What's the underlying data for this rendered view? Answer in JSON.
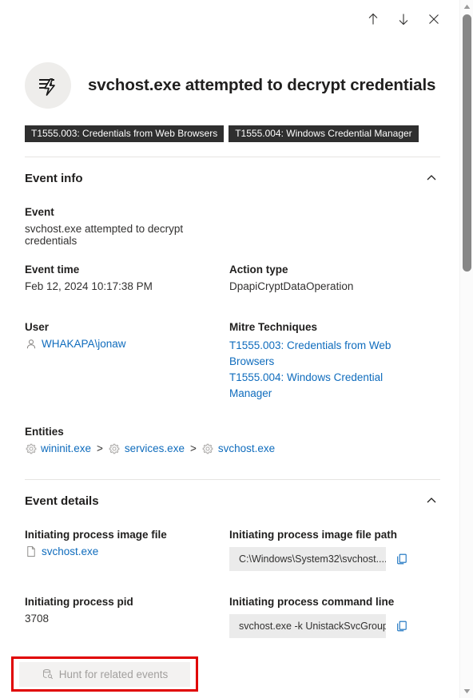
{
  "commandbar": {
    "buttons": [
      {
        "name": "previous-item",
        "icon": "arrow-up-icon",
        "label": "Up"
      },
      {
        "name": "next-item",
        "icon": "arrow-down-icon",
        "label": "Down"
      },
      {
        "name": "close-panel",
        "icon": "close-icon",
        "label": "Close"
      }
    ]
  },
  "header": {
    "icon": "alert-lightning-icon",
    "title": "svchost.exe attempted to decrypt credentials",
    "tags": [
      "T1555.003: Credentials from Web Browsers",
      "T1555.004: Windows Credential Manager"
    ]
  },
  "sections": {
    "event_info": {
      "title": "Event info",
      "collapse_icon": "chevron-up-icon",
      "fields": {
        "event": {
          "label": "Event",
          "value": "svchost.exe attempted to decrypt credentials"
        },
        "event_time": {
          "label": "Event time",
          "value": "Feb 12, 2024 10:17:38 PM"
        },
        "action_type": {
          "label": "Action type",
          "value": "DpapiCryptDataOperation"
        },
        "user": {
          "label": "User",
          "value": "WHAKAPA\\jonaw",
          "icon": "person-icon"
        },
        "mitre": {
          "label": "Mitre Techniques",
          "links": [
            "T1555.003: Credentials from Web Browsers",
            "T1555.004: Windows Credential Manager"
          ]
        },
        "entities": {
          "label": "Entities",
          "separator": ">",
          "items": [
            {
              "icon": "gear-icon",
              "label": "wininit.exe"
            },
            {
              "icon": "gear-icon",
              "label": "services.exe"
            },
            {
              "icon": "gear-icon",
              "label": "svchost.exe"
            }
          ]
        }
      }
    },
    "event_details": {
      "title": "Event details",
      "collapse_icon": "chevron-up-icon",
      "fields": {
        "image_file": {
          "label": "Initiating process image file",
          "value": "svchost.exe",
          "icon": "file-icon"
        },
        "image_file_path": {
          "label": "Initiating process image file path",
          "value": "C:\\Windows\\System32\\svchost....",
          "copy_icon": "copy-icon"
        },
        "pid": {
          "label": "Initiating process pid",
          "value": "3708"
        },
        "command_line": {
          "label": "Initiating process command line",
          "value": "svchost.exe -k UnistackSvcGroup",
          "copy_icon": "copy-icon"
        }
      }
    }
  },
  "footer": {
    "hunt_button": {
      "label": "Hunt for related events",
      "icon": "hunt-database-icon",
      "disabled": true
    },
    "highlight_color": "#e00000"
  },
  "scrollbar": {
    "up_icon": "scroll-up-arrow-icon",
    "down_icon": "scroll-down-arrow-icon"
  },
  "colors": {
    "link": "#0f6cbd",
    "tag_background": "#2f2f2f",
    "pill_background": "#ebebeb",
    "text": "#201f1e"
  }
}
